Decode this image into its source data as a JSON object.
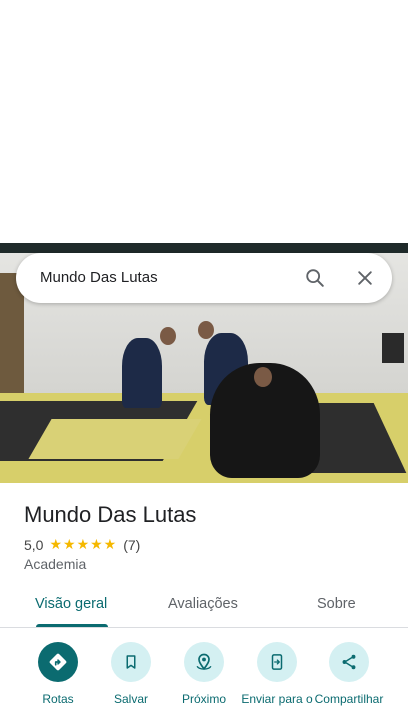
{
  "search": {
    "query": "Mundo Das Lutas",
    "search_icon": "search-icon",
    "close_icon": "close-icon"
  },
  "place": {
    "name": "Mundo Das Lutas",
    "rating": "5,0",
    "stars": "★★★★★",
    "review_count": "(7)",
    "category": "Academia"
  },
  "tabs": [
    {
      "label": "Visão geral",
      "active": true
    },
    {
      "label": "Avaliações",
      "active": false
    },
    {
      "label": "Sobre",
      "active": false
    }
  ],
  "actions": [
    {
      "label": "Rotas",
      "icon": "directions-icon"
    },
    {
      "label": "Salvar",
      "icon": "bookmark-icon"
    },
    {
      "label": "Próximo",
      "icon": "nearby-icon"
    },
    {
      "label": "Enviar para o",
      "icon": "send-to-phone-icon"
    },
    {
      "label": "Compartilhar",
      "icon": "share-icon"
    }
  ],
  "colors": {
    "accent": "#0b6b70",
    "accent_light": "#d4f0f2",
    "star": "#f5b800"
  }
}
